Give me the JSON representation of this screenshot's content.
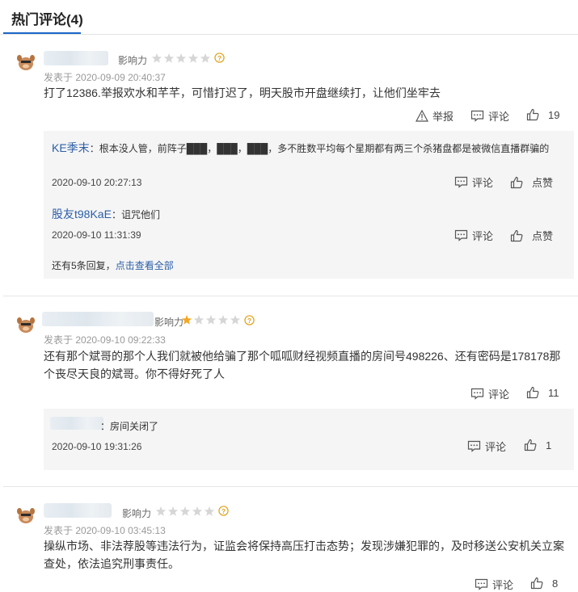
{
  "header": {
    "title": "热门评论(4)"
  },
  "labels": {
    "influence": "影响力",
    "posted_prefix": "发表于",
    "report": "举报",
    "comment": "评论",
    "like": "点赞"
  },
  "comments": [
    {
      "rating": 0,
      "date": "2020-09-09 20:40:37",
      "text": "打了12386.举报欢水和芊芊，可惜打迟了，明天股市开盘继续打，让他们坐牢去",
      "likes": "19",
      "replies": [
        {
          "user": "KE季末",
          "text": "：根本没人管，前阵子███，███，███，多不胜数平均每个星期都有两三个杀猪盘都是被微信直播群骗的",
          "date": "2020-09-10 20:27:13"
        },
        {
          "user": "股友t98KaE",
          "text": "：诅咒他们",
          "date": "2020-09-10 11:31:39"
        }
      ],
      "more_prefix": "还有5条回复，",
      "more_link": "点击查看全部"
    },
    {
      "rating": 1,
      "date": "2020-09-10 09:22:33",
      "text": "还有那个斌哥的那个人我们就被他给骗了那个呱呱财经视频直播的房间号498226、还有密码是178178那个丧尽天良的斌哥。你不得好死了人",
      "likes": "11",
      "replies": [
        {
          "user": "",
          "text": "：房间关闭了",
          "date": "2020-09-10 19:31:26",
          "likes": "1"
        }
      ]
    },
    {
      "rating": 0,
      "date": "2020-09-10 03:45:13",
      "text": "操纵市场、非法荐股等违法行为，证监会将保持高压打击态势；发现涉嫌犯罪的，及时移送公安机关立案查处，依法追究刑事责任。",
      "likes": "8"
    }
  ],
  "colors": {
    "link": "#2b5ea8",
    "accent": "#1a66c7",
    "star_on": "#f5a623",
    "star_off": "#d6d6d6"
  }
}
